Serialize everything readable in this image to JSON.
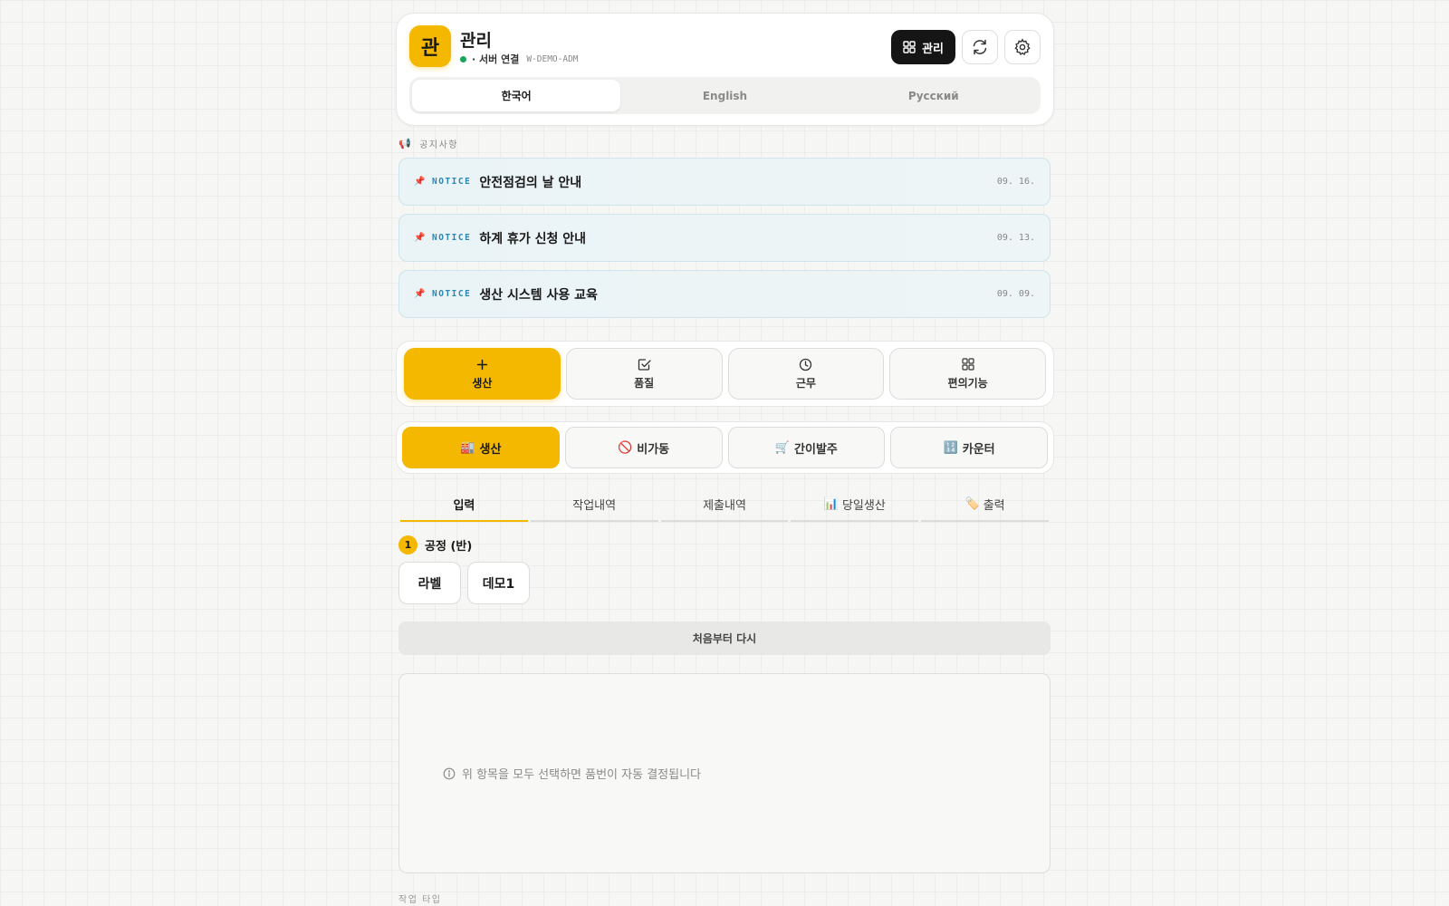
{
  "header": {
    "logo_char": "관",
    "title": "관리",
    "status_text": "· 서버 연결",
    "device_id": "W-DEMO-ADM",
    "admin_button": "관리",
    "languages": [
      "한국어",
      "English",
      "Русский"
    ]
  },
  "notices": {
    "section_label": "공지사항",
    "items": [
      {
        "tag": "NOTICE",
        "title": "안전점검의 날 안내",
        "date": "09. 16."
      },
      {
        "tag": "NOTICE",
        "title": "하계 휴가 신청 안내",
        "date": "09. 13."
      },
      {
        "tag": "NOTICE",
        "title": "생산 시스템 사용 교육",
        "date": "09. 09."
      }
    ]
  },
  "main_menu": [
    {
      "label": "생산",
      "icon": "plus-icon",
      "active": true
    },
    {
      "label": "품질",
      "icon": "check-square-icon"
    },
    {
      "label": "근무",
      "icon": "clock-icon"
    },
    {
      "label": "편의기능",
      "icon": "grid-icon"
    }
  ],
  "sub_menu": [
    {
      "emoji": "🏭",
      "label": "생산",
      "active": true
    },
    {
      "emoji": "🚫",
      "label": "비가동"
    },
    {
      "emoji": "🛒",
      "label": "간이발주"
    },
    {
      "emoji": "🔢",
      "label": "카운터"
    }
  ],
  "tabs": [
    {
      "label": "입력",
      "active": true
    },
    {
      "label": "작업내역"
    },
    {
      "label": "제출내역"
    },
    {
      "emoji": "📊",
      "label": "당일생산"
    },
    {
      "emoji": "🏷️",
      "label": "출력"
    }
  ],
  "step": {
    "number": "1",
    "label": "공정 (반)",
    "options": [
      "라벨",
      "데모1"
    ]
  },
  "restart_button": "처음부터 다시",
  "hint": "위 항목을 모두 선택하면 품번이 자동 결정됩니다",
  "footer_label": "작업 타입",
  "colors": {
    "accent": "#f5b800",
    "notice_tag": "#2a86b3",
    "status_ok": "#19a35b"
  }
}
